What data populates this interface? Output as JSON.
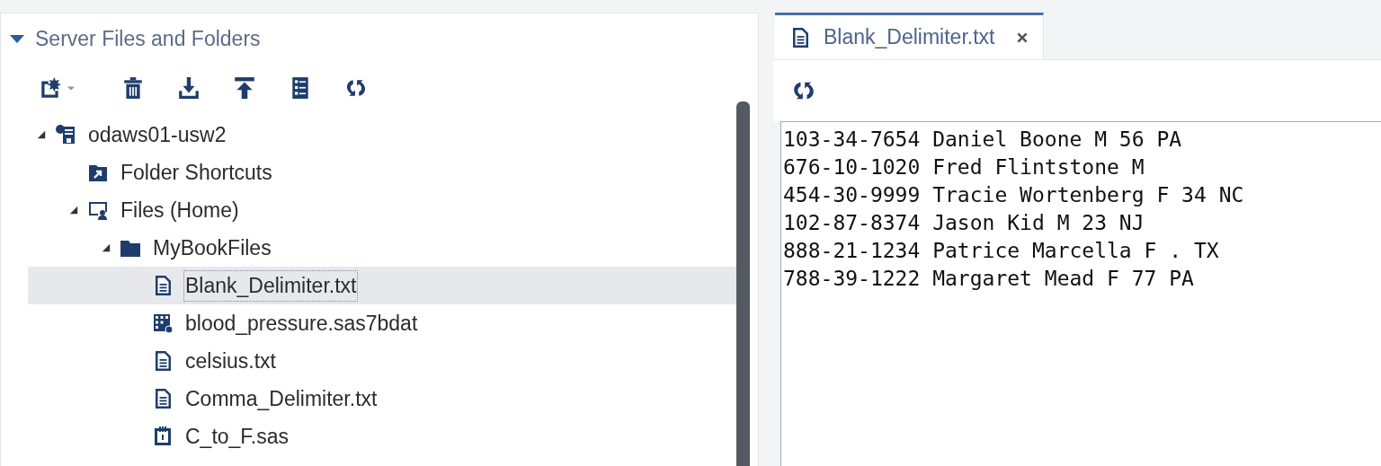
{
  "explorer": {
    "title": "Server Files and Folders",
    "expanded": true,
    "tree": [
      {
        "label": "odaws01-usw2",
        "kind": "server",
        "expanded": true,
        "selected": false,
        "children": [
          {
            "label": "Folder Shortcuts",
            "kind": "shortcuts",
            "selected": false
          },
          {
            "label": "Files (Home)",
            "kind": "home",
            "expanded": true,
            "selected": false,
            "children": [
              {
                "label": "MyBookFiles",
                "kind": "folder",
                "expanded": true,
                "selected": false,
                "children": [
                  {
                    "label": "Blank_Delimiter.txt",
                    "kind": "text",
                    "selected": true
                  },
                  {
                    "label": "blood_pressure.sas7bdat",
                    "kind": "dataset",
                    "selected": false
                  },
                  {
                    "label": "celsius.txt",
                    "kind": "text",
                    "selected": false
                  },
                  {
                    "label": "Comma_Delimiter.txt",
                    "kind": "text",
                    "selected": false
                  },
                  {
                    "label": "C_to_F.sas",
                    "kind": "program",
                    "selected": false
                  }
                ]
              }
            ]
          }
        ]
      }
    ]
  },
  "editor": {
    "tabs": [
      {
        "label": "Blank_Delimiter.txt",
        "selected": true
      }
    ],
    "lines": [
      "103-34-7654 Daniel Boone M 56 PA",
      "676-10-1020 Fred Flintstone M",
      "454-30-9999 Tracie Wortenberg F 34 NC",
      "102-87-8374 Jason Kid M 23 NJ",
      "888-21-1234 Patrice Marcella F . TX",
      "788-39-1222 Margaret Mead F 77 PA"
    ]
  }
}
